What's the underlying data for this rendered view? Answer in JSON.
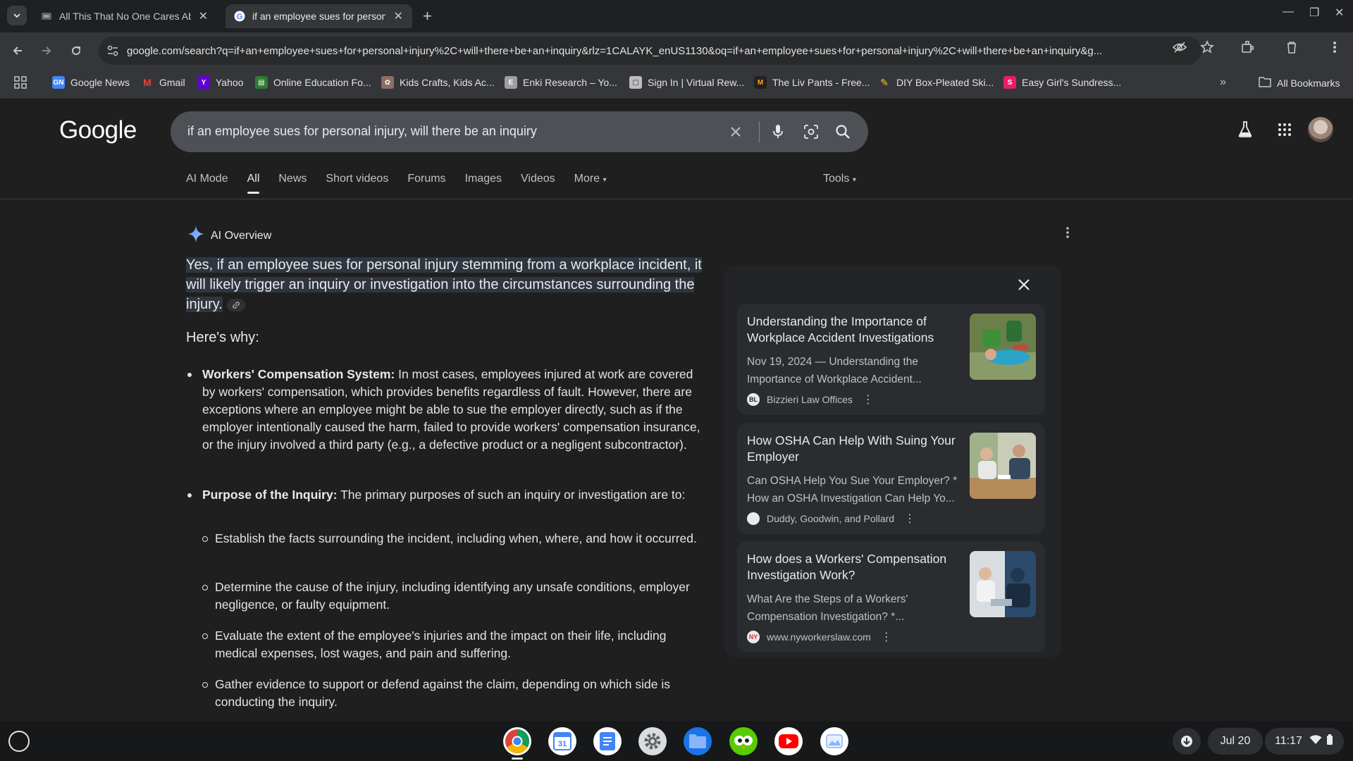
{
  "browser": {
    "tabs": [
      {
        "title": "All This That No One Cares About",
        "active": false
      },
      {
        "title": "if an employee sues for personal injury",
        "active": true
      }
    ],
    "url": "google.com/search?q=if+an+employee+sues+for+personal+injury%2C+will+there+be+an+inquiry&rlz=1CALAYK_enUS1130&oq=if+an+employee+sues+for+personal+injury%2C+will+there+be+an+inquiry&g...",
    "bookmarks": [
      {
        "label": "Google News",
        "icon": "google-news-icon",
        "color": "#4285f4"
      },
      {
        "label": "Gmail",
        "icon": "gmail-icon",
        "color": "#ea4335"
      },
      {
        "label": "Yahoo",
        "icon": "yahoo-icon",
        "color": "#6001d2"
      },
      {
        "label": "Online Education Fo...",
        "icon": "education-icon",
        "color": "#2e7d32"
      },
      {
        "label": "Kids Crafts, Kids Ac...",
        "icon": "crafts-icon",
        "color": "#8d6e63"
      },
      {
        "label": "Enki Research – Yo...",
        "icon": "enki-icon",
        "color": "#9e9e9e"
      },
      {
        "label": "Sign In | Virtual Rew...",
        "icon": "rewards-icon",
        "color": "#bdbdbd"
      },
      {
        "label": "The Liv Pants - Free...",
        "icon": "liv-pants-icon",
        "color": "#212121"
      },
      {
        "label": "DIY Box-Pleated Ski...",
        "icon": "diy-icon",
        "color": "#fbc02d"
      },
      {
        "label": "Easy Girl's Sundress...",
        "icon": "sundress-icon",
        "color": "#e91e63"
      }
    ],
    "all_bookmarks": "All Bookmarks"
  },
  "google": {
    "logo": "Google",
    "query": "if an employee sues for personal injury, will there be an inquiry",
    "tabs": [
      "AI Mode",
      "All",
      "News",
      "Short videos",
      "Forums",
      "Images",
      "Videos",
      "More"
    ],
    "active_tab": "All",
    "tools": "Tools"
  },
  "ai_overview": {
    "label": "AI Overview",
    "answer": "Yes, if an employee sues for personal injury stemming from a workplace incident, it will likely trigger an inquiry or investigation into the circumstances surrounding the injury.",
    "why": "Here's why:",
    "bullets": [
      {
        "title": "Workers' Compensation System:",
        "text": " In most cases, employees injured at work are covered by workers' compensation, which provides benefits regardless of fault. However, there are exceptions where an employee might be able to sue the employer directly, such as if the employer intentionally caused the harm, failed to provide workers' compensation insurance, or the injury involved a third party (e.g., a defective product or a negligent subcontractor)."
      },
      {
        "title": "Purpose of the Inquiry:",
        "text": " The primary purposes of such an inquiry or investigation are to:"
      }
    ],
    "sub_bullets": [
      "Establish the facts surrounding the incident, including when, where, and how it occurred.",
      "Determine the cause of the injury, including identifying any unsafe conditions, employer negligence, or faulty equipment.",
      "Evaluate the extent of the employee's injuries and the impact on their life, including medical expenses, lost wages, and pain and suffering.",
      "Gather evidence to support or defend against the claim, depending on which side is conducting the inquiry."
    ]
  },
  "sources": [
    {
      "title": "Understanding the Importance of Workplace Accident Investigations",
      "snippet": "Nov 19, 2024 — Understanding the Importance of Workplace Accident...",
      "site": "Bizzieri Law Offices",
      "site_initials": "BL"
    },
    {
      "title": "How OSHA Can Help With Suing Your Employer",
      "snippet": "Can OSHA Help You Sue Your Employer? * How an OSHA Investigation Can Help Yo...",
      "site": "Duddy, Goodwin, and Pollard",
      "site_initials": ""
    },
    {
      "title": "How does a Workers' Compensation Investigation Work?",
      "snippet": "What Are the Steps of a Workers' Compensation Investigation? *...",
      "site": "www.nyworkerslaw.com",
      "site_initials": "NY"
    }
  ],
  "shelf": {
    "date": "Jul 20",
    "time": "11:17",
    "apps": [
      {
        "icon": "chrome-icon",
        "color": "#ffffff"
      },
      {
        "icon": "calendar-icon",
        "color": "#ffffff"
      },
      {
        "icon": "docs-icon",
        "color": "#ffffff"
      },
      {
        "icon": "settings-icon",
        "color": "#dadce0"
      },
      {
        "icon": "files-icon",
        "color": "#1a73e8"
      },
      {
        "icon": "duolingo-icon",
        "color": "#58cc02"
      },
      {
        "icon": "youtube-icon",
        "color": "#ffffff"
      },
      {
        "icon": "photos-icon",
        "color": "#ffffff"
      }
    ]
  }
}
